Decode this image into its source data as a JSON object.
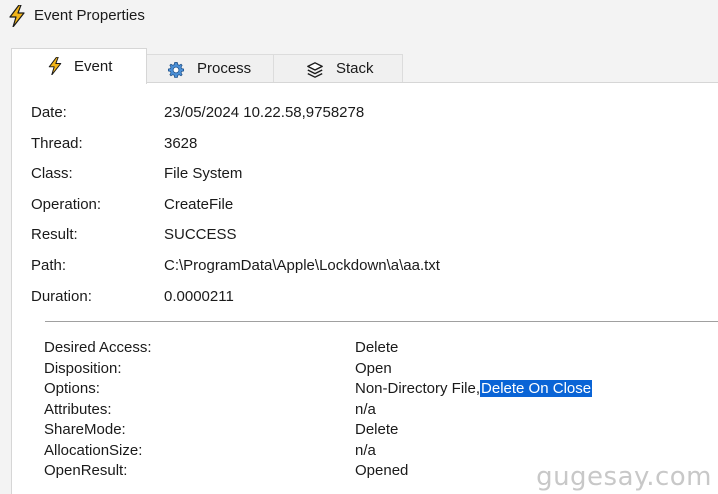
{
  "window": {
    "title": "Event Properties",
    "icon": "lightning-icon"
  },
  "tabs": [
    {
      "label": "Event",
      "icon": "lightning-icon",
      "active": true
    },
    {
      "label": "Process",
      "icon": "gear-icon",
      "active": false
    },
    {
      "label": "Stack",
      "icon": "layers-icon",
      "active": false
    }
  ],
  "properties": [
    {
      "label": "Date:",
      "value": "23/05/2024 10.22.58,9758278"
    },
    {
      "label": "Thread:",
      "value": "3628"
    },
    {
      "label": "Class:",
      "value": "File System"
    },
    {
      "label": "Operation:",
      "value": "CreateFile"
    },
    {
      "label": "Result:",
      "value": "SUCCESS"
    },
    {
      "label": "Path:",
      "value": "C:\\ProgramData\\Apple\\Lockdown\\a\\aa.txt"
    },
    {
      "label": "Duration:",
      "value": "0.0000211"
    }
  ],
  "details": [
    {
      "label": "Desired Access:",
      "value": "Delete"
    },
    {
      "label": "Disposition:",
      "value": "Open"
    },
    {
      "label": "Options:",
      "value": "Non-Directory File,",
      "selected": "Delete On Close"
    },
    {
      "label": "Attributes:",
      "value": "n/a"
    },
    {
      "label": "ShareMode:",
      "value": "Delete"
    },
    {
      "label": "AllocationSize:",
      "value": "n/a"
    },
    {
      "label": "OpenResult:",
      "value": "Opened"
    }
  ],
  "colors": {
    "selection": "#0a64d6",
    "lightning": "#f2b51a"
  },
  "watermark": "gugesay.com"
}
